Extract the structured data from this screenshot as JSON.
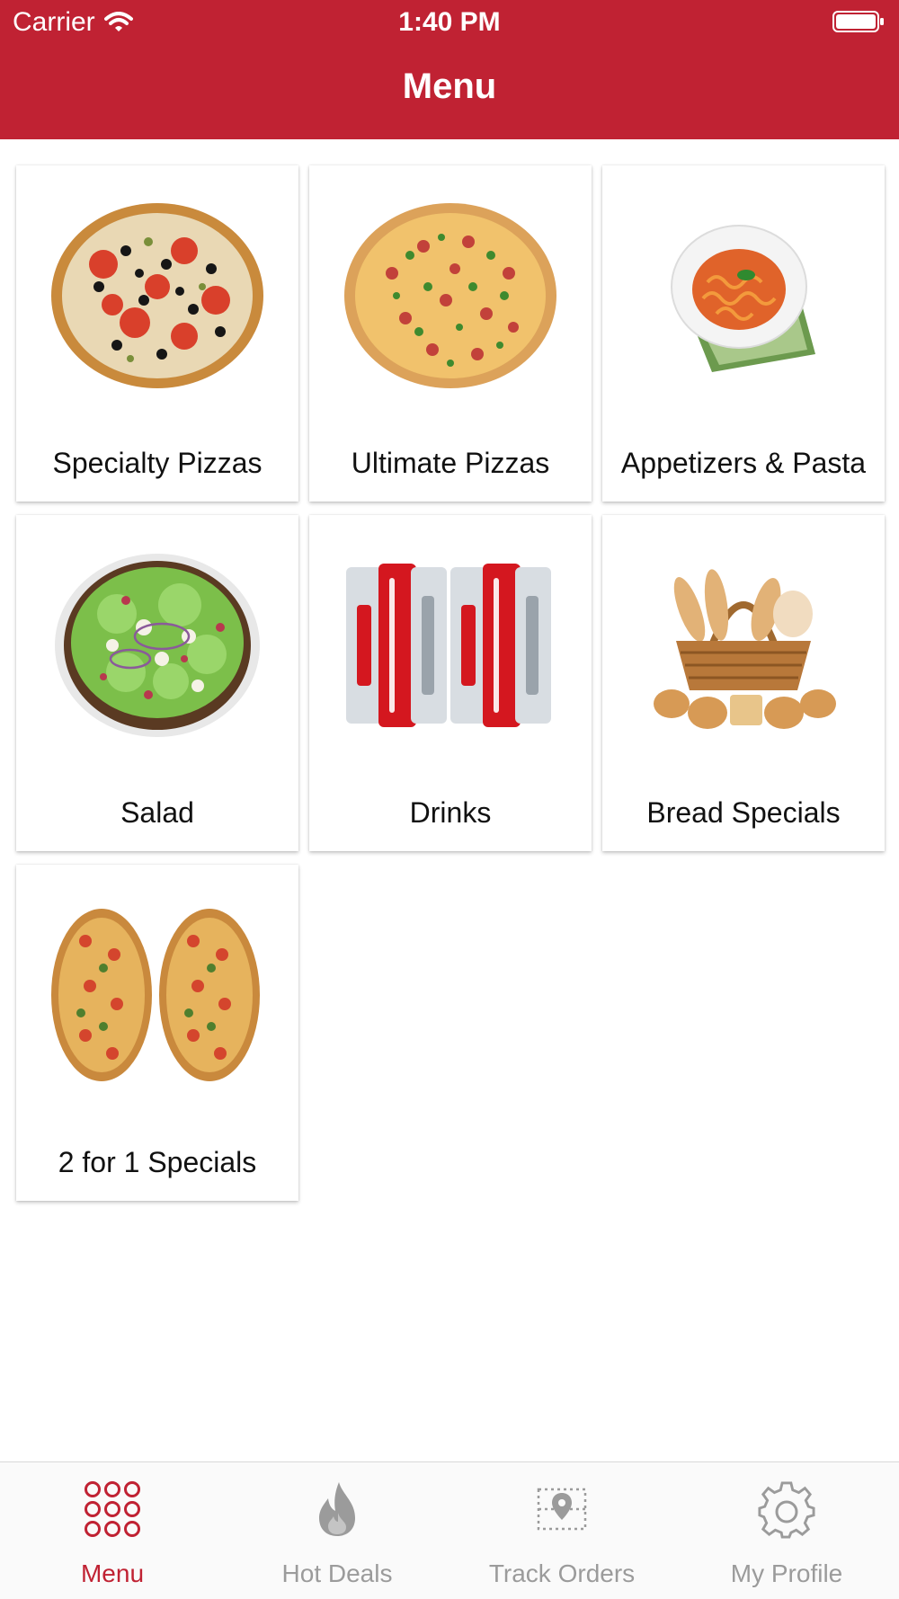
{
  "status": {
    "carrier": "Carrier",
    "time": "1:40 PM"
  },
  "header": {
    "title": "Menu"
  },
  "categories": [
    {
      "label": "Specialty Pizzas",
      "icon": "specialty-pizza-image"
    },
    {
      "label": "Ultimate Pizzas",
      "icon": "ultimate-pizza-image"
    },
    {
      "label": "Appetizers & Pasta",
      "icon": "pasta-image"
    },
    {
      "label": "Salad",
      "icon": "salad-image"
    },
    {
      "label": "Drinks",
      "icon": "coke-cans-image"
    },
    {
      "label": "Bread Specials",
      "icon": "bread-basket-image"
    },
    {
      "label": "2 for 1 Specials",
      "icon": "two-pizzas-image"
    }
  ],
  "tabs": [
    {
      "label": "Menu",
      "icon": "grid-dots-icon",
      "active": true
    },
    {
      "label": "Hot Deals",
      "icon": "flame-icon",
      "active": false
    },
    {
      "label": "Track Orders",
      "icon": "map-pin-icon",
      "active": false
    },
    {
      "label": "My Profile",
      "icon": "gear-icon",
      "active": false
    }
  ],
  "colors": {
    "brand_red": "#c02233",
    "tab_inactive": "#9b9b9b"
  }
}
